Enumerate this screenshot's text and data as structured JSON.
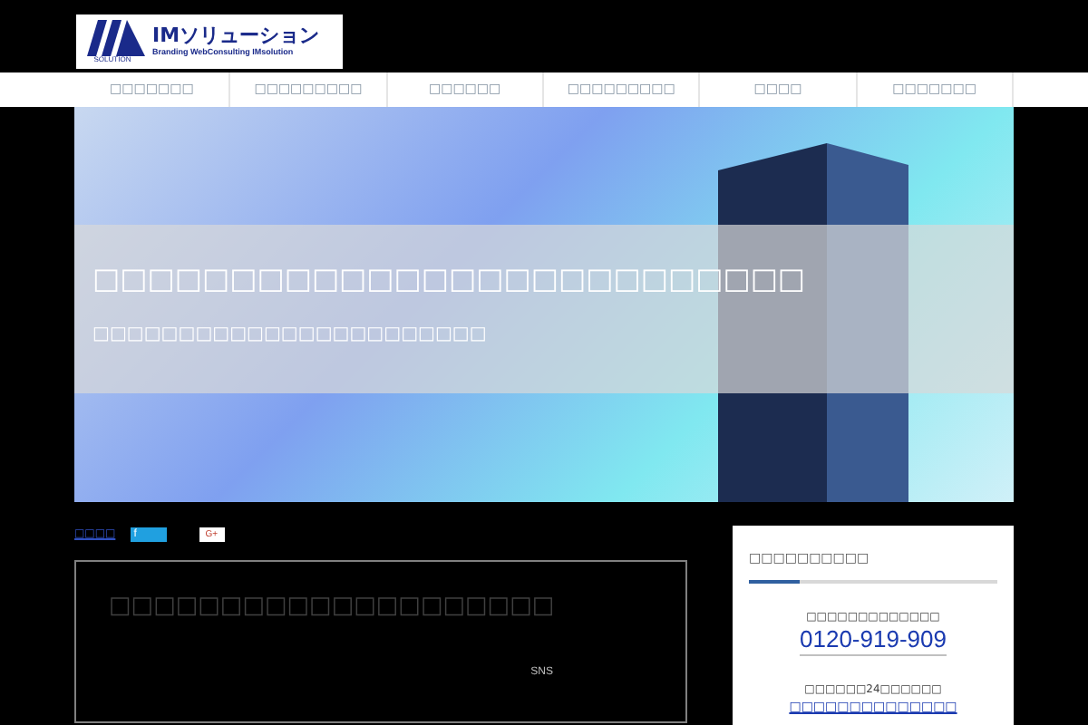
{
  "logo": {
    "name": "IMソリューション",
    "sub": "SOLUTION",
    "tagline": "Branding WebConsulting IMsolution"
  },
  "nav": [
    {
      "label": "□□□□□□□",
      "selected": false
    },
    {
      "label": "□□□□□□□□□",
      "selected": false
    },
    {
      "label": "□□□□□□",
      "selected": false
    },
    {
      "label": "□□□□□□□□□",
      "selected": false
    },
    {
      "label": "□□□□",
      "selected": false
    },
    {
      "label": "□□□□□□□",
      "selected": false
    }
  ],
  "hero": {
    "headline": "□□□□□□□□□□□□□□□□□□□□□□□□□□",
    "subline": "□□□□□□□□□□□□□□□□□□□□□□□"
  },
  "share": {
    "link": "□□□□",
    "facebook": "f",
    "gplus": "G+"
  },
  "main": {
    "title": "□□□□□□□□□□□□□□□□□□□□",
    "label": "SNS"
  },
  "sidebar": {
    "heading": "□□□□□□□□□□",
    "caption": "□□□□□□□□□□□□□",
    "phone": "0120-919-909",
    "hours": "□□□□□□24□□□□□□",
    "link": "□□□□□□□□□□□□□□"
  }
}
